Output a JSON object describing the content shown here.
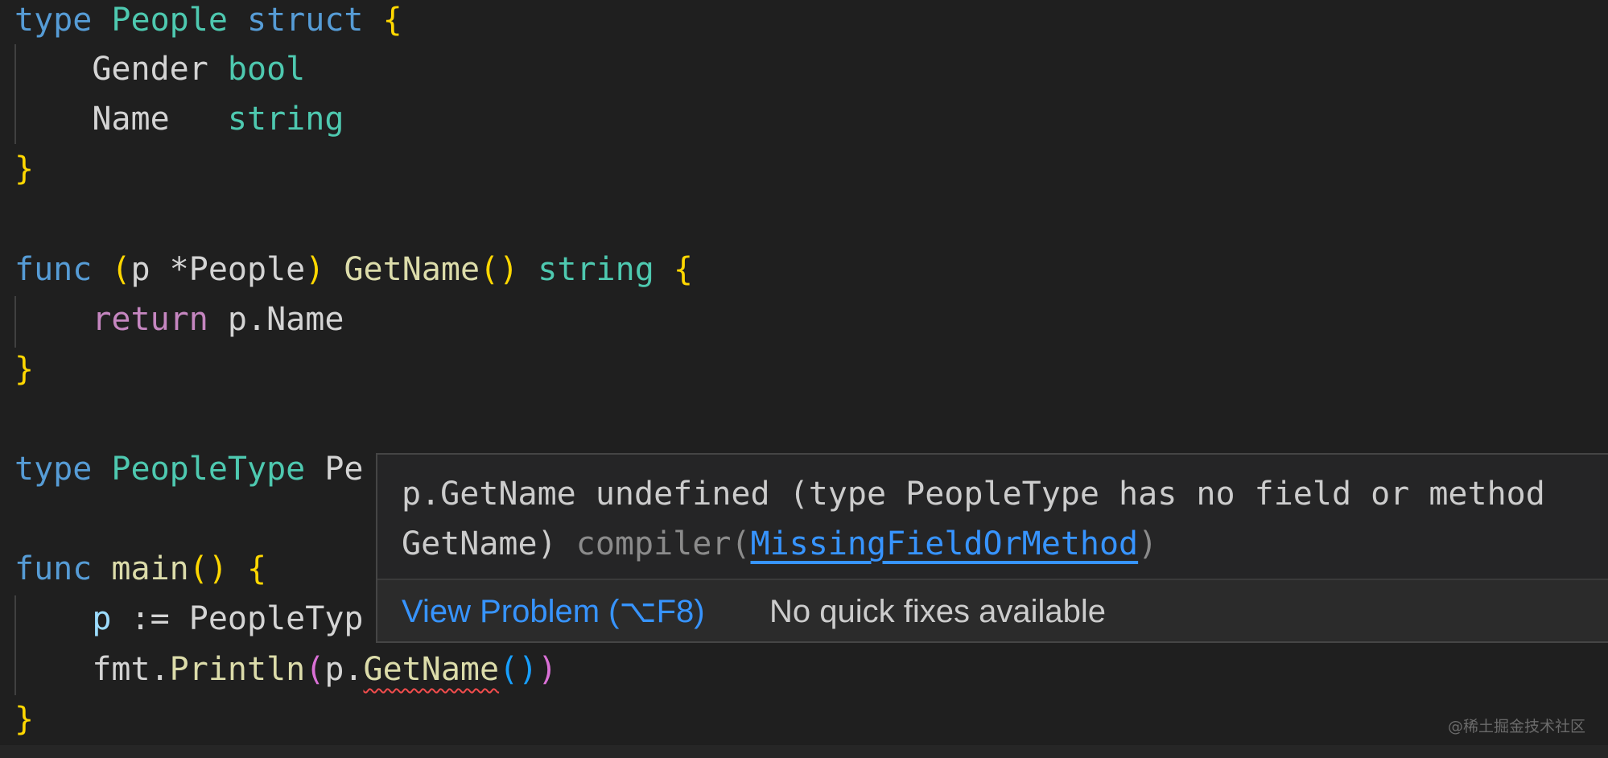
{
  "code": {
    "l1": {
      "kw": "type",
      "name": "People",
      "kw2": "struct",
      "brace": "{"
    },
    "l2": {
      "field": "Gender",
      "type": "bool"
    },
    "l3": {
      "field": "Name",
      "type": "string"
    },
    "l4": {
      "brace": "}"
    },
    "l5": {
      "kw": "func",
      "open": "(",
      "recv": "p *People",
      "close": ")",
      "fn": "GetName",
      "parens": "()",
      "ret": "string",
      "brace": "{"
    },
    "l6": {
      "kw": "return",
      "expr": "p.Name"
    },
    "l7": {
      "brace": "}"
    },
    "l8": {
      "kw": "type",
      "name": "PeopleType",
      "visible_rest": "Pe"
    },
    "l9": {
      "kw": "func",
      "fn": "main",
      "parens": "()",
      "brace": "{"
    },
    "l10": {
      "var": "p",
      "rest": "PeopleTyp"
    },
    "l11": {
      "pkg": "fmt.",
      "fn": "Println",
      "open": "(",
      "pre": "p.",
      "err": "GetName",
      "parens": "()",
      "close": ")"
    },
    "l12": {
      "brace": "}"
    }
  },
  "hover": {
    "message_line1": "p.GetName undefined (type PeopleType has no field or method",
    "message_line2": "GetName)",
    "source": "compiler(",
    "code": "MissingFieldOrMethod",
    "source_close": ")",
    "view_problem": "View Problem (⌥F8)",
    "no_fixes": "No quick fixes available"
  },
  "watermark": "@稀土掘金技术社区",
  "colors": {
    "background": "#1f1f1f",
    "keyword": "#569cd6",
    "type": "#4ec9b0",
    "function": "#dcdcaa",
    "bracket": "#ffd700",
    "error": "#f14c4c",
    "link": "#3794ff"
  }
}
